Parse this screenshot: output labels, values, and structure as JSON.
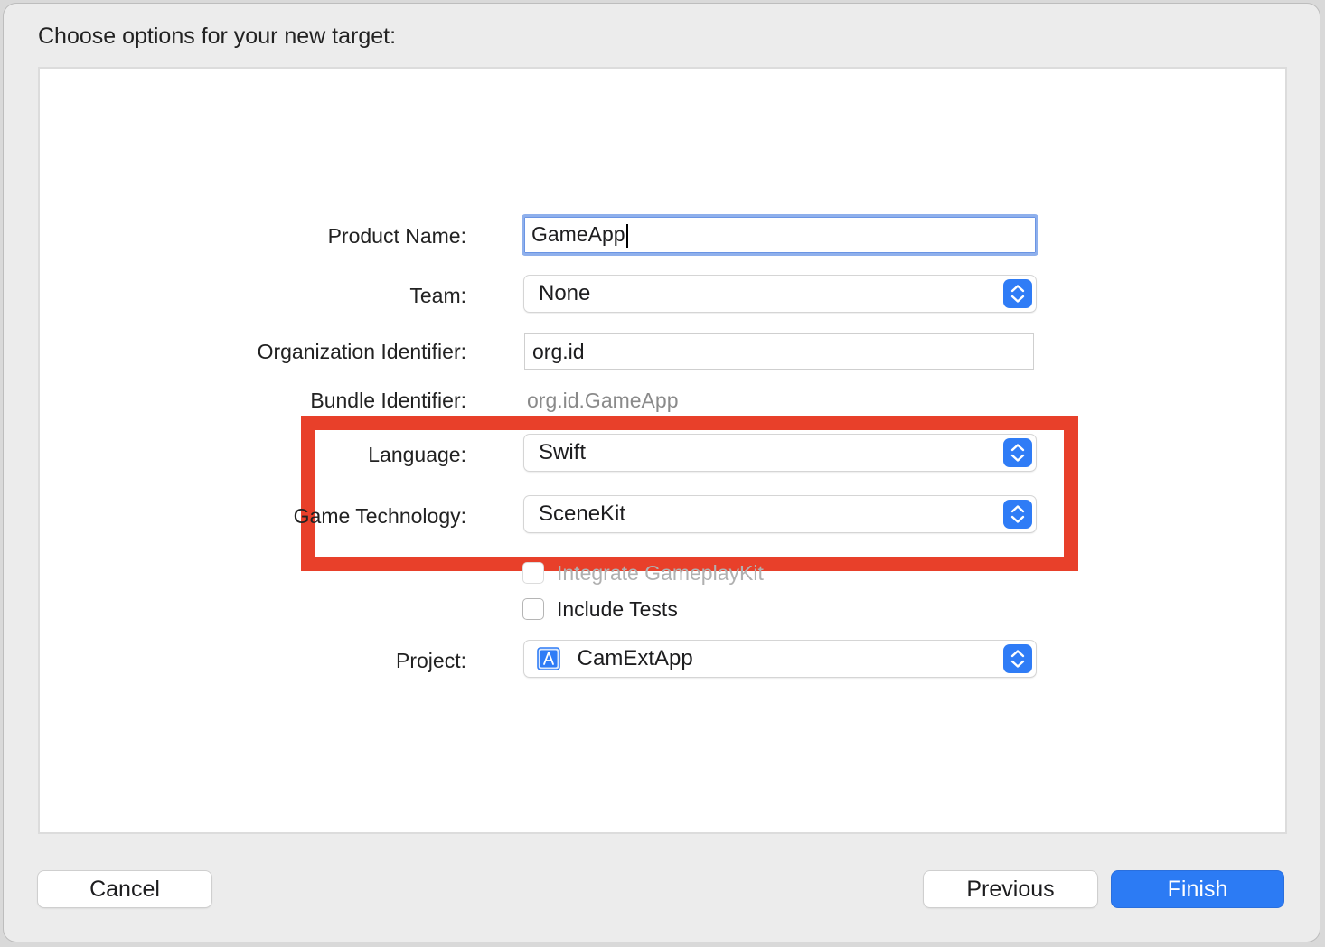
{
  "dialog": {
    "title": "Choose options for your new target:"
  },
  "form": {
    "product_name": {
      "label": "Product Name:",
      "value": "GameApp"
    },
    "team": {
      "label": "Team:",
      "value": "None"
    },
    "organization_identifier": {
      "label": "Organization Identifier:",
      "value": "org.id"
    },
    "bundle_identifier": {
      "label": "Bundle Identifier:",
      "value": "org.id.GameApp"
    },
    "language": {
      "label": "Language:",
      "value": "Swift"
    },
    "game_technology": {
      "label": "Game Technology:",
      "value": "SceneKit"
    },
    "integrate_gameplaykit": {
      "label": "Integrate GameplayKit",
      "checked": false,
      "enabled": false
    },
    "include_tests": {
      "label": "Include Tests",
      "checked": false,
      "enabled": true
    },
    "project": {
      "label": "Project:",
      "value": "CamExtApp",
      "icon": "app-project-icon"
    }
  },
  "buttons": {
    "cancel": "Cancel",
    "previous": "Previous",
    "finish": "Finish"
  },
  "annotation": {
    "highlight_color": "#e8402a"
  },
  "colors": {
    "accent": "#2c7bf4",
    "focus_ring": "#8fb0ec"
  }
}
